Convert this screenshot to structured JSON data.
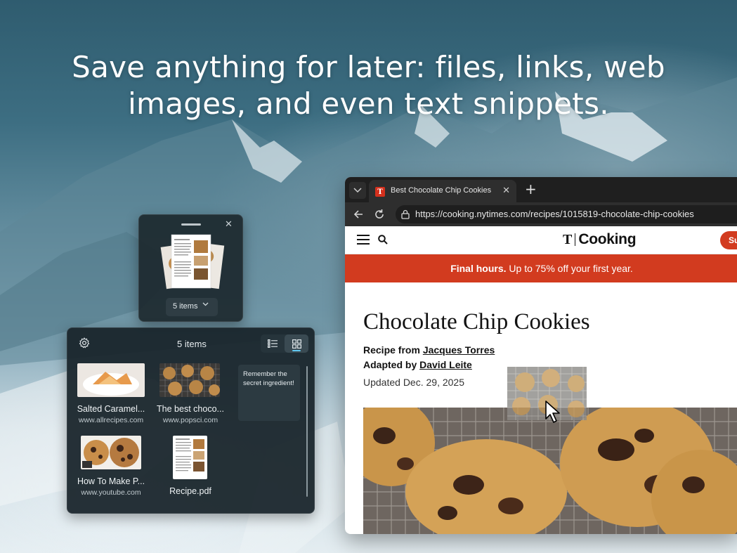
{
  "headline": {
    "line1": "Save anything for later: files, links, web",
    "line2": "images, and even text snippets."
  },
  "browser": {
    "tab_title": "Best Chocolate Chip Cookies",
    "url": "https://cooking.nytimes.com/recipes/1015819-chocolate-chip-cookies",
    "site": {
      "logo_t": "T",
      "logo_word": "Cooking",
      "subscribe": "Su",
      "promo_bold": "Final hours.",
      "promo_rest": " Up to 75% off your first year.",
      "recipe_title": "Chocolate Chip Cookies",
      "recipe_from_label": "Recipe from ",
      "recipe_from_name": "Jacques Torres",
      "adapted_label": "Adapted by ",
      "adapted_name": "David Leite",
      "updated": "Updated Dec. 29, 2025"
    }
  },
  "shelf_small": {
    "items_label": "5 items"
  },
  "shelf_large": {
    "count_label": "5 items",
    "items": [
      {
        "label": "Salted Caramel...",
        "url": "www.allrecipes.com"
      },
      {
        "label": "The best choco...",
        "url": "www.popsci.com"
      },
      {
        "label": "How To Make P...",
        "url": "www.youtube.com"
      },
      {
        "label": "Recipe.pdf",
        "url": ""
      }
    ],
    "note": "Remember the secret ingredient!"
  },
  "colors": {
    "accent": "#60c8f0",
    "brand_red": "#d23b1f",
    "shelf_bg": "#18242a"
  },
  "icons": [
    "chevron-down-icon",
    "nyt-favicon-icon",
    "close-icon",
    "plus-icon",
    "back-icon",
    "refresh-icon",
    "lock-icon",
    "menu-icon",
    "search-icon",
    "gear-icon",
    "list-view-icon",
    "grid-view-icon",
    "cursor-icon"
  ]
}
